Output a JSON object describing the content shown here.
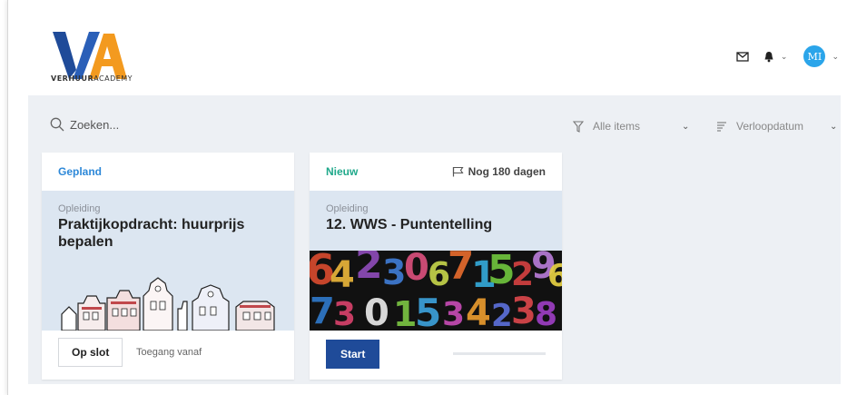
{
  "header": {
    "logo_text_bold": "VERHUUR",
    "logo_text_light": "ACADEMY",
    "avatar_initials": "MI",
    "icons": [
      "mail-icon",
      "bell-icon",
      "chevron-down-icon",
      "avatar",
      "chevron-down-icon"
    ]
  },
  "toolbar": {
    "search_placeholder": "Zoeken...",
    "filter_label": "Alle items",
    "sort_label": "Verloopdatum"
  },
  "cards": [
    {
      "status": "Gepland",
      "type": "Opleiding",
      "title": "Praktijkopdracht: huurprijs bepalen",
      "button": "Op slot",
      "access_text": "Toegang vanaf",
      "status_color": "#2d88d8"
    },
    {
      "status": "Nieuw",
      "deadline": "Nog 180 dagen",
      "type": "Opleiding",
      "title": "12. WWS - Puntentelling",
      "button": "Start",
      "progress": 0,
      "status_color": "#20a98b"
    }
  ],
  "colors": {
    "accent_blue": "#1f4b99",
    "avatar_bg": "#2ba5ea",
    "logo_blue": "#1f4b99",
    "logo_orange": "#f39a1f"
  }
}
